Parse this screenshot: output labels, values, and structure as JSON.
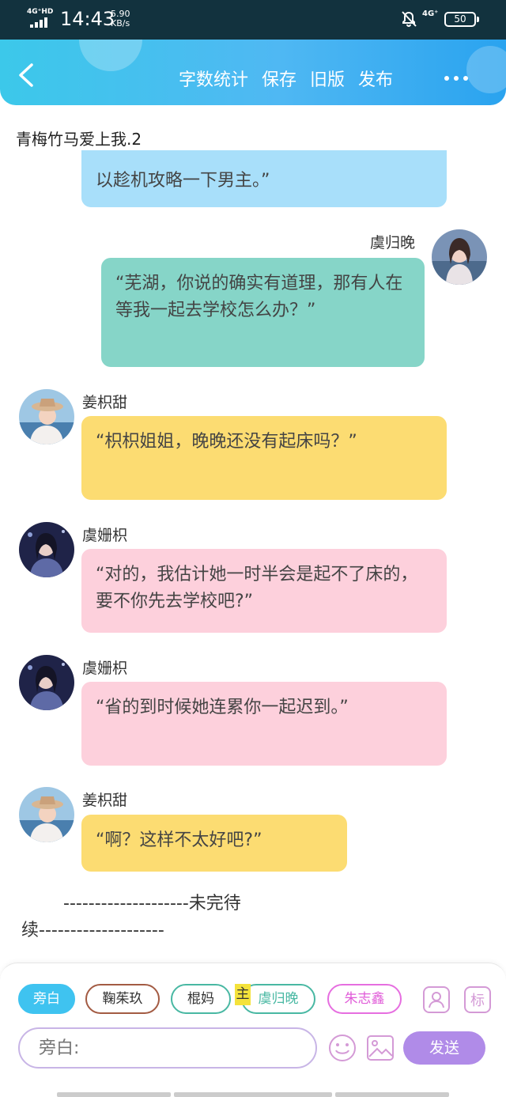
{
  "status_bar": {
    "network": "4G⁺HD",
    "time": "14:43",
    "speed_value": "5.90",
    "speed_unit": "KB/s",
    "network2": "4G⁺",
    "battery": "50"
  },
  "header": {
    "actions": [
      "字数统计",
      "保存",
      "旧版",
      "发布"
    ]
  },
  "doc_title": "青梅竹马爱上我.2",
  "messages": [
    {
      "speaker": "",
      "text": "以趁机攻略一下男主。”",
      "color": "#a8dffa"
    },
    {
      "speaker": "虞归晚",
      "text": "“芜湖，你说的确实有道理，那有人在等我一起去学校怎么办？”",
      "color": "#86d5c8"
    },
    {
      "speaker": "姜枳甜",
      "text": "“枳枳姐姐，晚晚还没有起床吗？”",
      "color": "#fcdc72"
    },
    {
      "speaker": "虞姗枳",
      "text": "“对的，我估计她一时半会是起不了床的，要不你先去学校吧?”",
      "color": "#fdd0dc"
    },
    {
      "speaker": "虞姗枳",
      "text": "“省的到时候她连累你一起迟到。”",
      "color": "#fdd0dc"
    },
    {
      "speaker": "姜枳甜",
      "text": "“啊？这样不太好吧?”",
      "color": "#fcdc72"
    }
  ],
  "ending": {
    "line1": "--------------------未完待",
    "line2": "续--------------------"
  },
  "roles": {
    "narration": "旁白",
    "r1": "鞠茱玖",
    "r2": "棍妈",
    "r2_flag": "主",
    "r3": "虞归晚",
    "r4": "朱志鑫"
  },
  "input": {
    "placeholder": "旁白:"
  },
  "send_label": "发送",
  "icons": {
    "back": "chevron-left-icon",
    "more": "more-dots-icon",
    "avatar_add": "person-add-icon",
    "tag": "tag-icon",
    "emoji": "smiley-icon",
    "image": "image-icon"
  }
}
